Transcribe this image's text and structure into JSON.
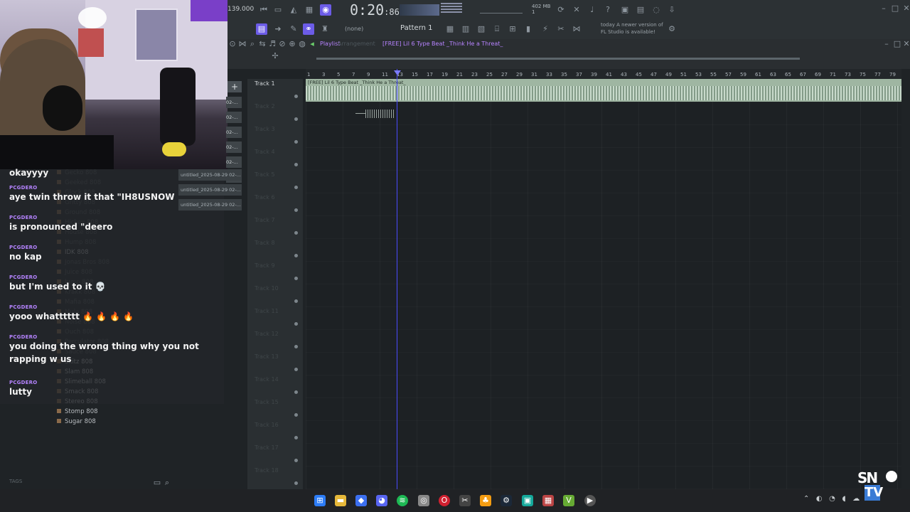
{
  "toolbar": {
    "tempo": "139.000",
    "time": "0:20",
    "time_frac": "86",
    "pattern": "Pattern 1",
    "pattern_none": "(none)",
    "memory": "402 MB",
    "memory_sub": "1",
    "news_line1": "today  A newer version of",
    "news_line2": "FL Studio is available!"
  },
  "playlist": {
    "title": "Playlist",
    "breadcrumb": "Arrangement",
    "song": "[FREE] Lil 6 Type Beat _Think He a Threat_",
    "clip_name": "[FREE] Lil 6 Type Beat _Think He a Threat_",
    "ruler": [
      "1",
      "3",
      "5",
      "7",
      "9",
      "11",
      "13",
      "15",
      "17",
      "19",
      "21",
      "23",
      "25",
      "27",
      "29",
      "31",
      "33",
      "35",
      "37",
      "39",
      "41",
      "43",
      "45",
      "47",
      "49",
      "51",
      "53",
      "55",
      "57",
      "59",
      "61",
      "63",
      "65",
      "67",
      "69",
      "71",
      "73",
      "75",
      "77",
      "79"
    ],
    "tracks": [
      "Track 1",
      "Track 2",
      "Track 3",
      "Track 4",
      "Track 5",
      "Track 6",
      "Track 7",
      "Track 8",
      "Track 9",
      "Track 10",
      "Track 11",
      "Track 12",
      "Track 13",
      "Track 14",
      "Track 15",
      "Track 16",
      "Track 17",
      "Track 18"
    ]
  },
  "windows": {
    "stack": [
      "02-...",
      "02-...",
      "02-...",
      "02-...",
      "02-...",
      "02-..."
    ],
    "untitled": [
      "untitled_2025-08-29 02-...",
      "untitled_2025-08-29 02-...",
      "untitled_2025-08-29 02-..."
    ]
  },
  "chat": [
    {
      "user": "",
      "text": "okayyyy"
    },
    {
      "user": "PCGDERO",
      "text": "aye twin throw it that \"IH8USNOW"
    },
    {
      "user": "PCGDERO",
      "text": "is pronounced \"deero"
    },
    {
      "user": "PCGDERO",
      "text": "no kap"
    },
    {
      "user": "PCGDERO",
      "text": "but I'm used to it 💀"
    },
    {
      "user": "PCGDERO",
      "text": "yooo whatttttt 🔥 🔥 🔥 🔥"
    },
    {
      "user": "PCGDERO",
      "text": "you doing the wrong thing why you not rapping w us"
    },
    {
      "user": "PCGDERO",
      "text": "lutty"
    }
  ],
  "browser": [
    {
      "label": "Gecko 808",
      "dim": true
    },
    {
      "label": "Geeked 808",
      "dim": true
    },
    {
      "label": "Glock 808",
      "dim": true
    },
    {
      "label": "Gritty 808",
      "dim": true
    },
    {
      "label": "Ground 808",
      "dim": true
    },
    {
      "label": "Hickey 808",
      "dim": true
    },
    {
      "label": "House 808",
      "dim": true
    },
    {
      "label": "Hump 808",
      "dim": true
    },
    {
      "label": "IDK 808",
      "dim": false
    },
    {
      "label": "Jonas Bros 808",
      "dim": true
    },
    {
      "label": "Juice 808",
      "dim": true
    },
    {
      "label": "Jump 808",
      "dim": true
    },
    {
      "label": "Krakk 808",
      "dim": true
    },
    {
      "label": "Mafia 808",
      "dim": true
    },
    {
      "label": "Mula 808",
      "dim": true
    },
    {
      "label": "Noise 808",
      "dim": true
    },
    {
      "label": "Ouch 808",
      "dim": true
    },
    {
      "label": "Perculator 808",
      "dim": true
    },
    {
      "label": "Sauce 808",
      "dim": true
    },
    {
      "label": "Skitz 808",
      "dim": false
    },
    {
      "label": "Slam 808",
      "dim": false
    },
    {
      "label": "Slimeball 808",
      "dim": false
    },
    {
      "label": "Smack 808",
      "dim": false
    },
    {
      "label": "Stereo 808",
      "dim": false
    },
    {
      "label": "Stomp 808",
      "dim": false
    },
    {
      "label": "Sugar 808",
      "dim": false
    }
  ],
  "browser_footer": "TAGS",
  "logo": {
    "top": "SN",
    "bottom": "TV"
  },
  "colors": {
    "accent": "#6c5ce7",
    "username": "#b583ff",
    "clip": "#9fb6a2",
    "playhead": "#4a4aff"
  }
}
